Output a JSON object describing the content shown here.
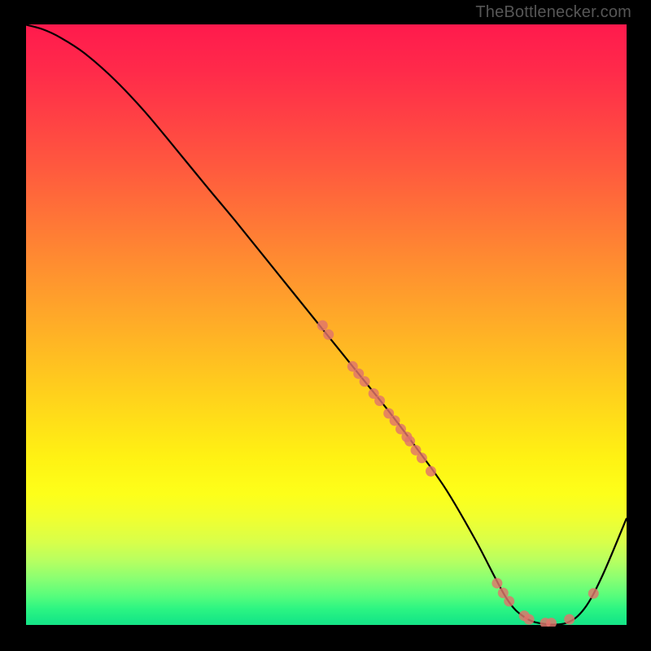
{
  "watermark": "TheBottlenecker.com",
  "chart_data": {
    "type": "line",
    "title": "",
    "xlabel": "",
    "ylabel": "",
    "xlim": [
      0,
      100
    ],
    "ylim": [
      0,
      100
    ],
    "x": [
      0,
      3,
      6,
      10,
      15,
      20,
      25,
      30,
      35,
      40,
      45,
      50,
      55,
      60,
      65,
      70,
      75,
      80,
      83,
      86,
      90,
      93,
      96,
      100
    ],
    "values": [
      100,
      99.2,
      97.8,
      95.2,
      90.8,
      85.5,
      79.5,
      73.4,
      67.4,
      61.2,
      55.0,
      48.8,
      42.6,
      36.4,
      29.8,
      22.8,
      14.2,
      4.8,
      1.6,
      0.5,
      0.6,
      3.0,
      8.5,
      18.0
    ],
    "scatter_points": [
      {
        "x": 49.5,
        "y": 50.0
      },
      {
        "x": 50.5,
        "y": 48.5
      },
      {
        "x": 54.5,
        "y": 43.2
      },
      {
        "x": 55.5,
        "y": 42.0
      },
      {
        "x": 56.5,
        "y": 40.7
      },
      {
        "x": 58.0,
        "y": 38.7
      },
      {
        "x": 59.0,
        "y": 37.5
      },
      {
        "x": 60.5,
        "y": 35.4
      },
      {
        "x": 61.5,
        "y": 34.2
      },
      {
        "x": 62.5,
        "y": 32.8
      },
      {
        "x": 63.5,
        "y": 31.5
      },
      {
        "x": 64.0,
        "y": 30.8
      },
      {
        "x": 65.0,
        "y": 29.3
      },
      {
        "x": 66.0,
        "y": 28.0
      },
      {
        "x": 67.5,
        "y": 25.8
      },
      {
        "x": 78.5,
        "y": 7.2
      },
      {
        "x": 79.5,
        "y": 5.6
      },
      {
        "x": 80.5,
        "y": 4.2
      },
      {
        "x": 83.0,
        "y": 1.8
      },
      {
        "x": 83.8,
        "y": 1.2
      },
      {
        "x": 86.5,
        "y": 0.6
      },
      {
        "x": 87.5,
        "y": 0.6
      },
      {
        "x": 90.5,
        "y": 1.2
      },
      {
        "x": 94.5,
        "y": 5.5
      }
    ],
    "colors": {
      "curve": "#000000",
      "scatter": "#e0746b",
      "gradient_top": "#ff1a4d",
      "gradient_bottom": "#16e086"
    }
  }
}
